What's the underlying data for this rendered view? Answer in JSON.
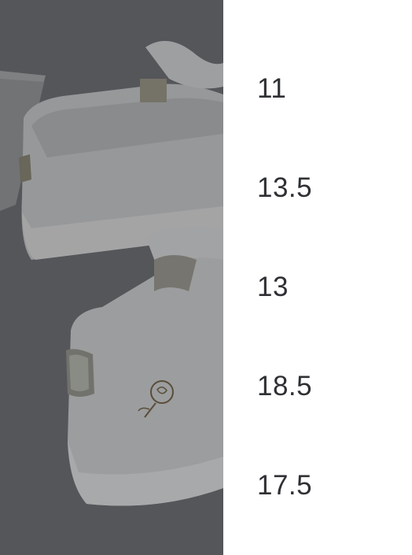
{
  "size_picker": {
    "options": [
      {
        "label": "11"
      },
      {
        "label": "13.5"
      },
      {
        "label": "13"
      },
      {
        "label": "18.5"
      },
      {
        "label": "17.5"
      }
    ]
  },
  "product_image": {
    "icon": "sneaker-photo"
  },
  "colors": {
    "panel_background": "#ffffff",
    "option_text": "#2e3034",
    "photo_backdrop": "#5f6165"
  }
}
